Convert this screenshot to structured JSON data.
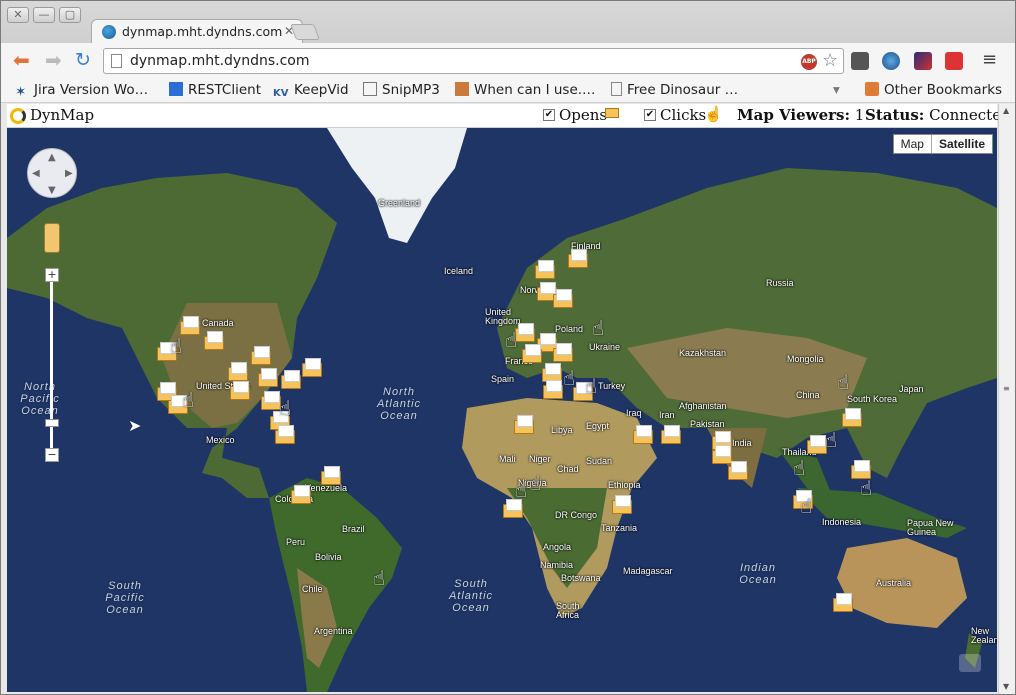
{
  "browser": {
    "tab_title": "dynmap.mht.dyndns.com",
    "url": "dynmap.mht.dyndns.com",
    "window_buttons": [
      "✕",
      "—",
      "▢"
    ]
  },
  "bookmarks": [
    {
      "label": "Jira Version Wo…",
      "icon": "jira-icon"
    },
    {
      "label": "RESTClient",
      "icon": "restclient-icon"
    },
    {
      "label": "KeepVid",
      "icon": "keepvid-icon",
      "prefix": "KV"
    },
    {
      "label": "SnipMP3",
      "icon": "snipmp3-icon"
    },
    {
      "label": "When can I use.…",
      "icon": "caniuse-icon"
    },
    {
      "label": "Free Dinosaur …",
      "icon": "page-icon"
    },
    {
      "label": "Other Bookmarks",
      "icon": "folder-icon"
    }
  ],
  "app": {
    "brand": "DynMap",
    "opens_label": "Opens",
    "clicks_label": "Clicks",
    "viewers_label": "Map Viewers:",
    "viewers_value": "1",
    "status_label": "Status:",
    "status_value": "Connected!"
  },
  "map": {
    "type_map": "Map",
    "type_satellite": "Satellite",
    "selected_type": "Satellite",
    "zoom_in": "+",
    "zoom_out": "−",
    "labels": [
      "Greenland",
      "Iceland",
      "Finland",
      "Norway",
      "Russia",
      "United Kingdom",
      "Poland",
      "Ukraine",
      "France",
      "Spain",
      "Turkey",
      "Kazakhstan",
      "Mongolia",
      "China",
      "South Korea",
      "Japan",
      "Iraq",
      "Iran",
      "Afghanistan",
      "Pakistan",
      "India",
      "Thailand",
      "Libya",
      "Egypt",
      "Mali",
      "Niger",
      "Chad",
      "Sudan",
      "Ethiopia",
      "Nigeria",
      "DR Congo",
      "Tanzania",
      "Angola",
      "Namibia",
      "Botswana",
      "Madagascar",
      "South Africa",
      "Canada",
      "United States",
      "Mexico",
      "Colombia",
      "Venezuela",
      "Peru",
      "Brazil",
      "Bolivia",
      "Chile",
      "Argentina",
      "Indonesia",
      "Papua New Guinea",
      "Australia",
      "New Zealand"
    ],
    "oceans": [
      "North Pacific Ocean",
      "North Atlantic Ocean",
      "South Pacific Ocean",
      "South Atlantic Ocean",
      "Indian Ocean"
    ]
  }
}
